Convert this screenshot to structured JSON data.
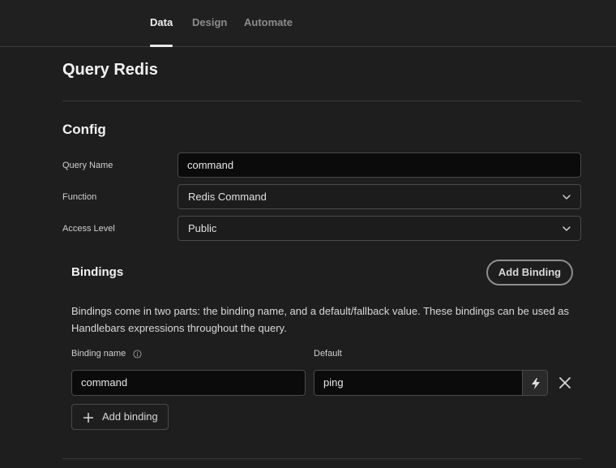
{
  "tabs": [
    {
      "label": "Data",
      "active": true
    },
    {
      "label": "Design",
      "active": false
    },
    {
      "label": "Automate",
      "active": false
    }
  ],
  "page_title": "Query Redis",
  "config": {
    "title": "Config",
    "query_name_label": "Query Name",
    "query_name_value": "command",
    "function_label": "Function",
    "function_value": "Redis Command",
    "access_label": "Access Level",
    "access_value": "Public"
  },
  "bindings": {
    "title": "Bindings",
    "add_button": "Add Binding",
    "description": "Bindings come in two parts: the binding name, and a default/fallback value. These bindings can be used as Handlebars expressions throughout the query.",
    "name_column": "Binding name",
    "default_column": "Default",
    "rows": [
      {
        "name": "command",
        "default": "ping"
      }
    ],
    "add_row_label": "Add binding"
  },
  "icons": {
    "info": "info-icon",
    "chevron": "chevron-down-icon",
    "bolt": "lightning-icon",
    "close": "close-icon",
    "plus": "plus-icon"
  },
  "colors": {
    "background": "#1e1e1e",
    "input_background": "#0b0b0b",
    "border": "#4a4a4a",
    "text": "#e8e8e8"
  }
}
